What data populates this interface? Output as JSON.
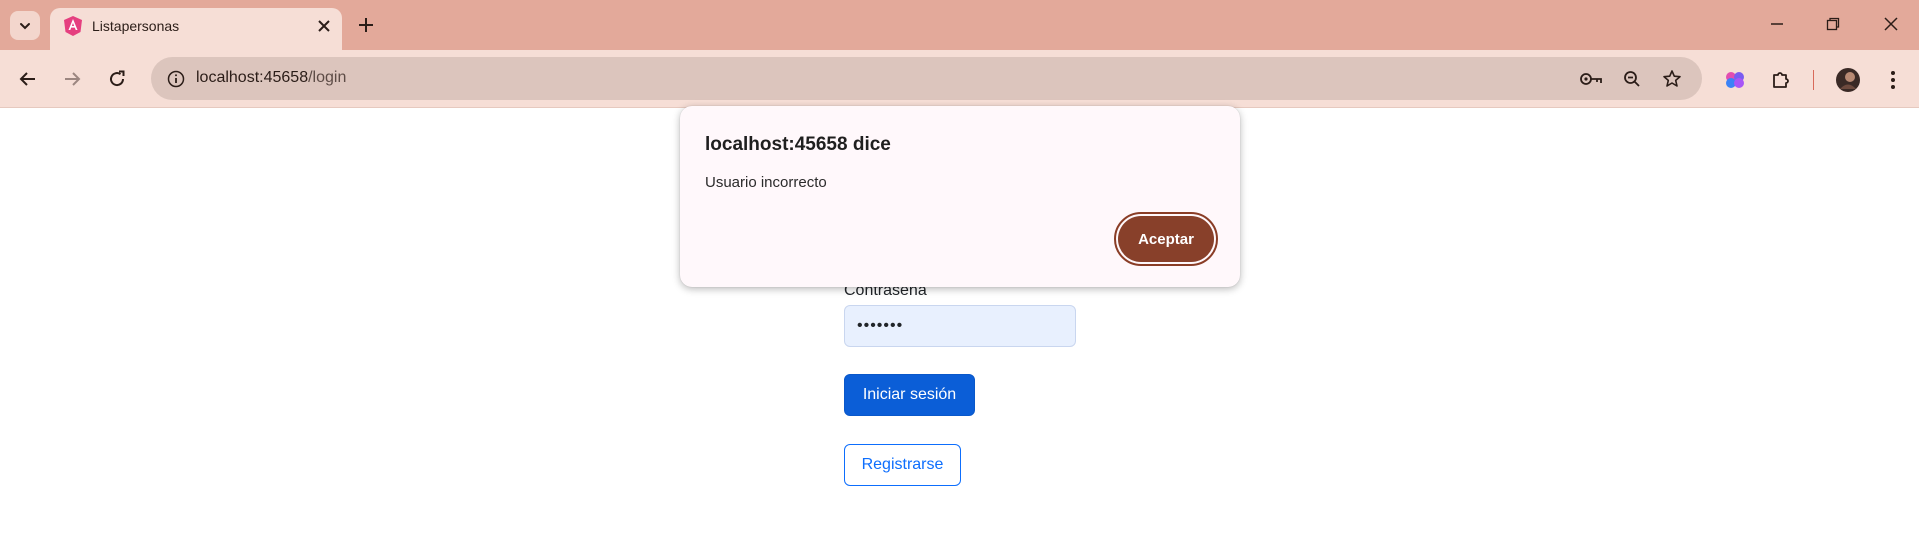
{
  "browser": {
    "tab_title": "Listapersonas",
    "url_host": "localhost:45658",
    "url_path": "/login"
  },
  "form": {
    "password_label": "Contraseña",
    "password_value": "•••••••",
    "login_button": "Iniciar sesión",
    "register_button": "Registrarse"
  },
  "dialog": {
    "title": "localhost:45658 dice",
    "message": "Usuario incorrecto",
    "ok_button": "Aceptar"
  },
  "colors": {
    "titlebar": "#e3a99a",
    "toolbar": "#f6ded6",
    "primary": "#0b5ed7",
    "dialog_button": "#88402a"
  }
}
